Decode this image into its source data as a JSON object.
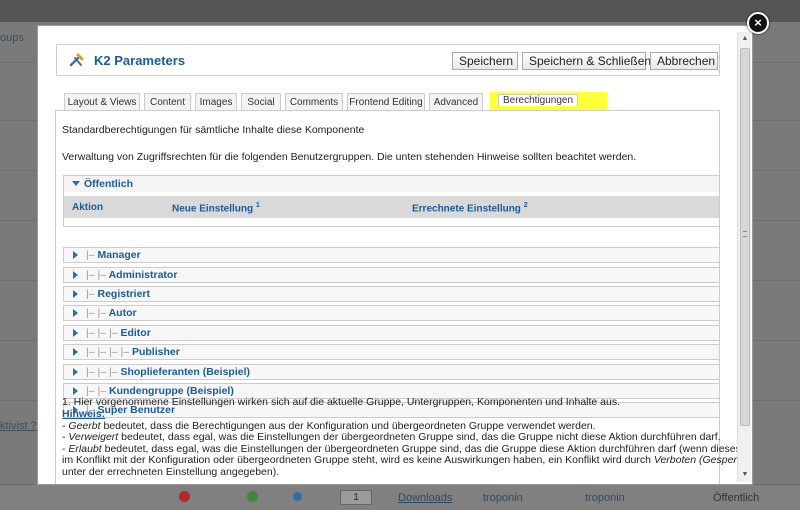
{
  "background": {
    "left_texts": [
      "oups",
      "ktivist ?"
    ],
    "bottom_row": {
      "number": "1",
      "link": "Downloads",
      "user1": "troponin",
      "user2": "troponin",
      "access": "Öffentlich"
    }
  },
  "modal": {
    "title": "K2 Parameters",
    "buttons": {
      "save": "Speichern",
      "save_close": "Speichern & Schließen",
      "cancel": "Abbrechen"
    },
    "tabs": [
      {
        "label": "Layout & Views"
      },
      {
        "label": "Content"
      },
      {
        "label": "Images"
      },
      {
        "label": "Social"
      },
      {
        "label": "Comments"
      },
      {
        "label": "Frontend Editing"
      },
      {
        "label": "Advanced"
      },
      {
        "label": "Berechtigungen"
      }
    ],
    "intro1": "Standardberechtigungen für sämtliche Inhalte diese Komponente",
    "intro2": "Verwaltung von Zugriffsrechten für die folgenden Benutzergruppen. Die unten stehenden Hinweise sollten beachtet werden.",
    "expanded_group": "Öffentlich",
    "columns": {
      "action": "Aktion",
      "new_setting": "Neue Einstellung",
      "computed_setting": "Errechnete Einstellung",
      "new_sup": "1",
      "computed_sup": "2"
    },
    "groups": [
      {
        "tree": "|–",
        "name": "Manager"
      },
      {
        "tree": "|– |–",
        "name": "Administrator"
      },
      {
        "tree": "|–",
        "name": "Registriert"
      },
      {
        "tree": "|– |–",
        "name": "Autor"
      },
      {
        "tree": "|– |– |–",
        "name": "Editor"
      },
      {
        "tree": "|– |– |– |–",
        "name": "Publisher"
      },
      {
        "tree": "|– |– |–",
        "name": "Shoplieferanten (Beispiel)"
      },
      {
        "tree": "|– |–",
        "name": "Kundengruppe (Beispiel)"
      },
      {
        "tree": "|–",
        "name": "Super Benutzer"
      }
    ],
    "notes": {
      "note1": "1. Hier vorgenommene Einstellungen wirken sich auf die aktuelle Gruppe, Untergruppen, Komponenten und Inhalte aus.",
      "hint_label": "Hinweis:",
      "inherited_term": "Geerbt",
      "inherited_text": " bedeutet, dass die Berechtigungen aus der Konfiguration und übergeordneten Gruppe verwendet werden.",
      "denied_term": "Verweigert",
      "denied_text": " bedeutet, dass egal, was die Einstellungen der übergeordneten Gruppe sind, das die Gruppe nicht diese Aktion durchführen darf.",
      "allowed_term": "Erlaubt",
      "allowed_text": " bedeutet, dass egal, was die Einstellungen der übergeordneten Gruppe sind, das die Gruppe diese Aktion durchführen darf (wenn dieses",
      "allowed_text2": "im Konflikt mit der Konfiguration oder übergeordneten Gruppe steht, wird es keine Auswirkungen haben, ein Konflikt wird durch ",
      "forbidden_term": "Verboten (Gesperrt)",
      "last_line": "unter der errechneten Einstellung angegeben)."
    }
  },
  "colors": {
    "accent": "#1a5c99",
    "highlight_tab": "#ffff3a"
  }
}
